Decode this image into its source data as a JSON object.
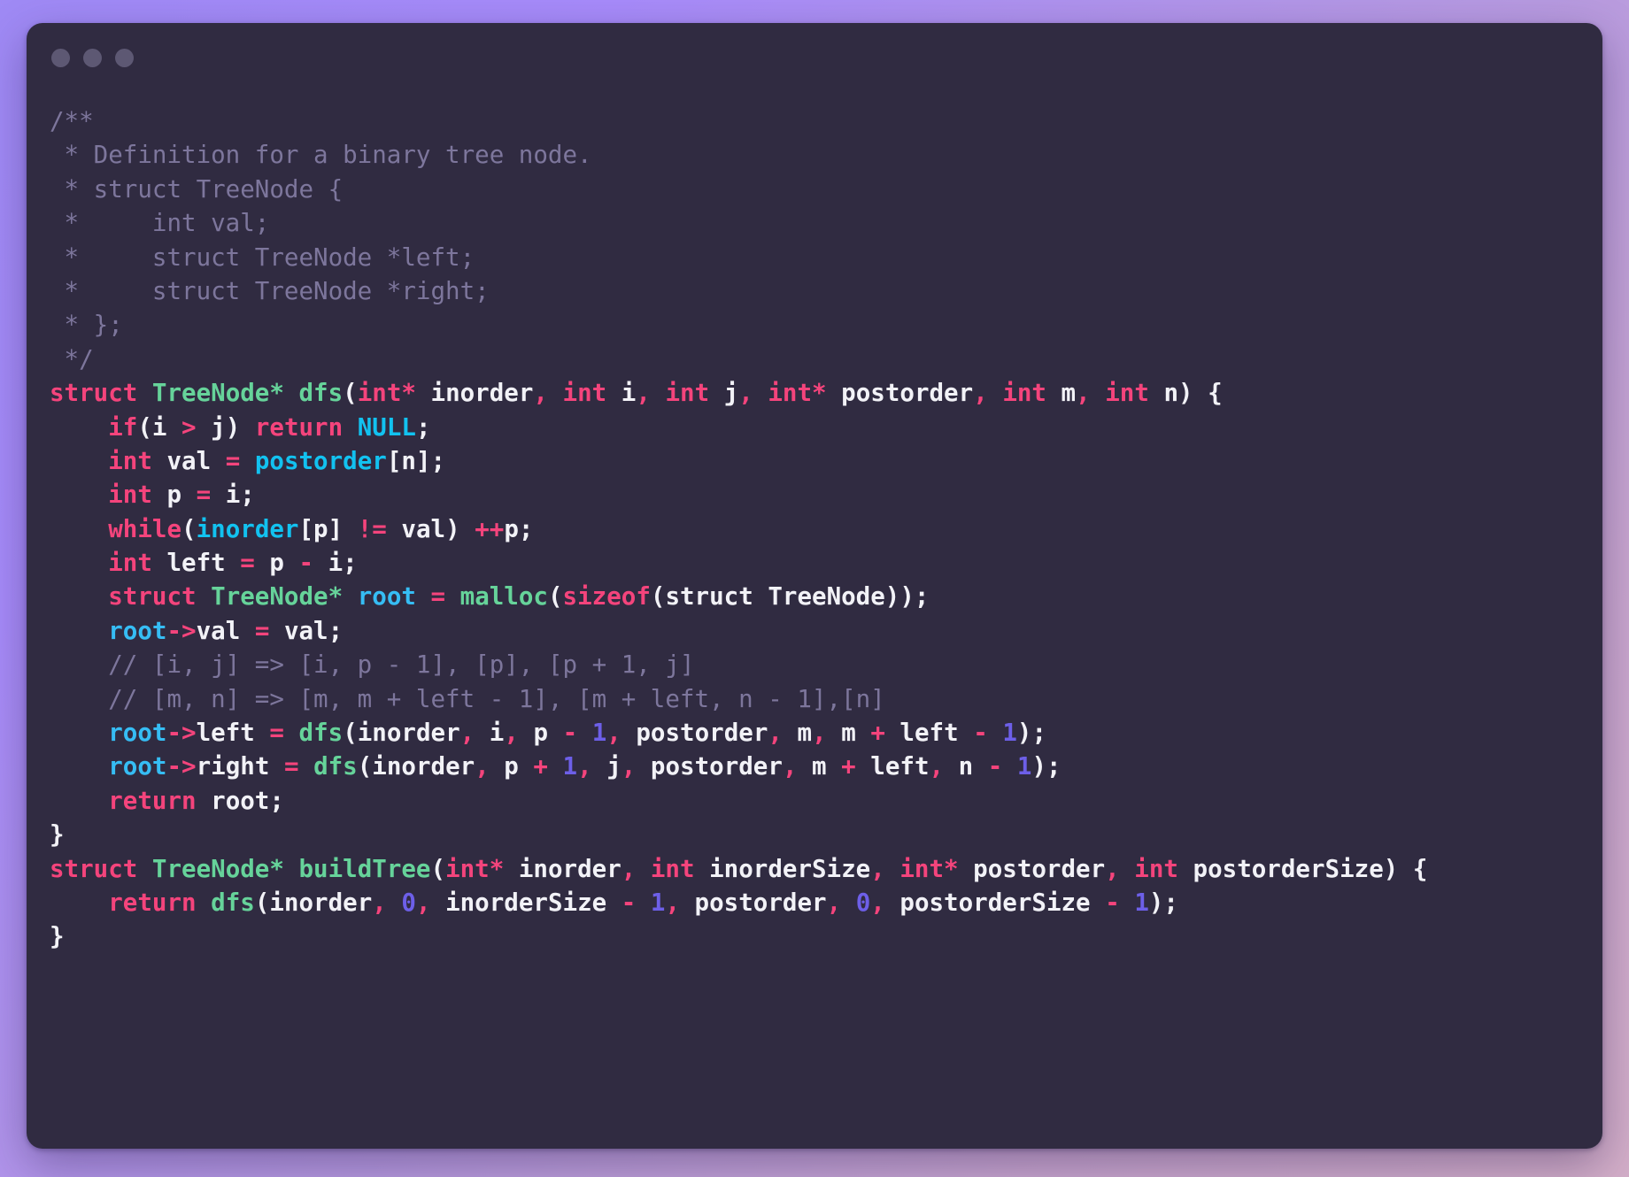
{
  "window": {
    "title_bar": {
      "dots": [
        {
          "name": "close-dot",
          "color": "#5d5873"
        },
        {
          "name": "minimize-dot",
          "color": "#5d5873"
        },
        {
          "name": "maximize-dot",
          "color": "#5d5873"
        }
      ]
    },
    "background_color": "#302b41",
    "page_background": "#a78bfa"
  },
  "theme": {
    "comment": "#7d769c",
    "keyword": "#f4447c",
    "type": "#66d39a",
    "function": "#66d39a",
    "variable": "#36bdf4",
    "constant": "#12c2f0",
    "number": "#6d5fe8",
    "operator": "#f4447c",
    "plain": "#f2f2f7"
  },
  "code": {
    "language": "c",
    "plain_text": "/**\n * Definition for a binary tree node.\n * struct TreeNode {\n *     int val;\n *     struct TreeNode *left;\n *     struct TreeNode *right;\n * };\n */\nstruct TreeNode* dfs(int* inorder, int i, int j, int* postorder, int m, int n) {\n    if(i > j) return NULL;\n    int val = postorder[n];\n    int p = i;\n    while(inorder[p] != val) ++p;\n    int left = p - i;\n    struct TreeNode* root = malloc(sizeof(struct TreeNode));\n    root->val = val;\n    // [i, j] => [i, p - 1], [p], [p + 1, j]\n    // [m, n] => [m, m + left - 1], [m + left, n - 1],[n]\n    root->left = dfs(inorder, i, p - 1, postorder, m, m + left - 1);\n    root->right = dfs(inorder, p + 1, j, postorder, m + left, n - 1);\n    return root;\n}\nstruct TreeNode* buildTree(int* inorder, int inorderSize, int* postorder, int postorderSize) {\n    return dfs(inorder, 0, inorderSize - 1, postorder, 0, postorderSize - 1);\n}",
    "lines": [
      {
        "n": 1,
        "tokens": [
          {
            "t": "/**",
            "c": "cm"
          }
        ]
      },
      {
        "n": 2,
        "tokens": [
          {
            "t": " * Definition for a binary tree node.",
            "c": "cm"
          }
        ]
      },
      {
        "n": 3,
        "tokens": [
          {
            "t": " * struct TreeNode {",
            "c": "cm"
          }
        ]
      },
      {
        "n": 4,
        "tokens": [
          {
            "t": " *     int val;",
            "c": "cm"
          }
        ]
      },
      {
        "n": 5,
        "tokens": [
          {
            "t": " *     struct TreeNode *left;",
            "c": "cm"
          }
        ]
      },
      {
        "n": 6,
        "tokens": [
          {
            "t": " *     struct TreeNode *right;",
            "c": "cm"
          }
        ]
      },
      {
        "n": 7,
        "tokens": [
          {
            "t": " * };",
            "c": "cm"
          }
        ]
      },
      {
        "n": 8,
        "tokens": [
          {
            "t": " */",
            "c": "cm"
          }
        ]
      },
      {
        "n": 9,
        "tokens": [
          {
            "t": "struct",
            "c": "kw"
          },
          {
            "t": " ",
            "c": "pl"
          },
          {
            "t": "TreeNode*",
            "c": "typ"
          },
          {
            "t": " ",
            "c": "pl"
          },
          {
            "t": "dfs",
            "c": "fn"
          },
          {
            "t": "(",
            "c": "pl"
          },
          {
            "t": "int*",
            "c": "kw"
          },
          {
            "t": " inorder",
            "c": "pl"
          },
          {
            "t": ",",
            "c": "op"
          },
          {
            "t": " ",
            "c": "pl"
          },
          {
            "t": "int",
            "c": "kw"
          },
          {
            "t": " i",
            "c": "pl"
          },
          {
            "t": ",",
            "c": "op"
          },
          {
            "t": " ",
            "c": "pl"
          },
          {
            "t": "int",
            "c": "kw"
          },
          {
            "t": " j",
            "c": "pl"
          },
          {
            "t": ",",
            "c": "op"
          },
          {
            "t": " ",
            "c": "pl"
          },
          {
            "t": "int*",
            "c": "kw"
          },
          {
            "t": " postorder",
            "c": "pl"
          },
          {
            "t": ",",
            "c": "op"
          },
          {
            "t": " ",
            "c": "pl"
          },
          {
            "t": "int",
            "c": "kw"
          },
          {
            "t": " m",
            "c": "pl"
          },
          {
            "t": ",",
            "c": "op"
          },
          {
            "t": " ",
            "c": "pl"
          },
          {
            "t": "int",
            "c": "kw"
          },
          {
            "t": " n) {",
            "c": "pl"
          }
        ]
      },
      {
        "n": 10,
        "tokens": [
          {
            "t": "    ",
            "c": "pl"
          },
          {
            "t": "if",
            "c": "kw"
          },
          {
            "t": "(i ",
            "c": "pl"
          },
          {
            "t": ">",
            "c": "op"
          },
          {
            "t": " j) ",
            "c": "pl"
          },
          {
            "t": "return",
            "c": "kw"
          },
          {
            "t": " ",
            "c": "pl"
          },
          {
            "t": "NULL",
            "c": "cst"
          },
          {
            "t": ";",
            "c": "pl"
          }
        ]
      },
      {
        "n": 11,
        "tokens": [
          {
            "t": "    ",
            "c": "pl"
          },
          {
            "t": "int",
            "c": "kw"
          },
          {
            "t": " val ",
            "c": "pl"
          },
          {
            "t": "=",
            "c": "op"
          },
          {
            "t": " ",
            "c": "pl"
          },
          {
            "t": "postorder",
            "c": "cst"
          },
          {
            "t": "[n];",
            "c": "pl"
          }
        ]
      },
      {
        "n": 12,
        "tokens": [
          {
            "t": "    ",
            "c": "pl"
          },
          {
            "t": "int",
            "c": "kw"
          },
          {
            "t": " p ",
            "c": "pl"
          },
          {
            "t": "=",
            "c": "op"
          },
          {
            "t": " i;",
            "c": "pl"
          }
        ]
      },
      {
        "n": 13,
        "tokens": [
          {
            "t": "    ",
            "c": "pl"
          },
          {
            "t": "while",
            "c": "kw"
          },
          {
            "t": "(",
            "c": "pl"
          },
          {
            "t": "inorder",
            "c": "cst"
          },
          {
            "t": "[p] ",
            "c": "pl"
          },
          {
            "t": "!=",
            "c": "op"
          },
          {
            "t": " val) ",
            "c": "pl"
          },
          {
            "t": "++",
            "c": "op"
          },
          {
            "t": "p;",
            "c": "pl"
          }
        ]
      },
      {
        "n": 14,
        "tokens": [
          {
            "t": "    ",
            "c": "pl"
          },
          {
            "t": "int",
            "c": "kw"
          },
          {
            "t": " left ",
            "c": "pl"
          },
          {
            "t": "=",
            "c": "op"
          },
          {
            "t": " p ",
            "c": "pl"
          },
          {
            "t": "-",
            "c": "op"
          },
          {
            "t": " i;",
            "c": "pl"
          }
        ]
      },
      {
        "n": 15,
        "tokens": [
          {
            "t": "    ",
            "c": "pl"
          },
          {
            "t": "struct",
            "c": "kw"
          },
          {
            "t": " ",
            "c": "pl"
          },
          {
            "t": "TreeNode*",
            "c": "typ"
          },
          {
            "t": " ",
            "c": "pl"
          },
          {
            "t": "root",
            "c": "var"
          },
          {
            "t": " ",
            "c": "pl"
          },
          {
            "t": "=",
            "c": "op"
          },
          {
            "t": " ",
            "c": "pl"
          },
          {
            "t": "malloc",
            "c": "fn"
          },
          {
            "t": "(",
            "c": "pl"
          },
          {
            "t": "sizeof",
            "c": "kw"
          },
          {
            "t": "(struct TreeNode));",
            "c": "pl"
          }
        ]
      },
      {
        "n": 16,
        "tokens": [
          {
            "t": "    ",
            "c": "pl"
          },
          {
            "t": "root",
            "c": "var"
          },
          {
            "t": "->",
            "c": "op"
          },
          {
            "t": "val ",
            "c": "pl"
          },
          {
            "t": "=",
            "c": "op"
          },
          {
            "t": " val;",
            "c": "pl"
          }
        ]
      },
      {
        "n": 17,
        "tokens": [
          {
            "t": "    // [i, j] => [i, p - 1], [p], [p + 1, j]",
            "c": "cm"
          }
        ]
      },
      {
        "n": 18,
        "tokens": [
          {
            "t": "    // [m, n] => [m, m + left - 1], [m + left, n - 1],[n]",
            "c": "cm"
          }
        ]
      },
      {
        "n": 19,
        "tokens": [
          {
            "t": "    ",
            "c": "pl"
          },
          {
            "t": "root",
            "c": "var"
          },
          {
            "t": "->",
            "c": "op"
          },
          {
            "t": "left ",
            "c": "pl"
          },
          {
            "t": "=",
            "c": "op"
          },
          {
            "t": " ",
            "c": "pl"
          },
          {
            "t": "dfs",
            "c": "fn"
          },
          {
            "t": "(inorder",
            "c": "pl"
          },
          {
            "t": ",",
            "c": "op"
          },
          {
            "t": " i",
            "c": "pl"
          },
          {
            "t": ",",
            "c": "op"
          },
          {
            "t": " p ",
            "c": "pl"
          },
          {
            "t": "-",
            "c": "op"
          },
          {
            "t": " ",
            "c": "pl"
          },
          {
            "t": "1",
            "c": "num"
          },
          {
            "t": ",",
            "c": "op"
          },
          {
            "t": " postorder",
            "c": "pl"
          },
          {
            "t": ",",
            "c": "op"
          },
          {
            "t": " m",
            "c": "pl"
          },
          {
            "t": ",",
            "c": "op"
          },
          {
            "t": " m ",
            "c": "pl"
          },
          {
            "t": "+",
            "c": "op"
          },
          {
            "t": " left ",
            "c": "pl"
          },
          {
            "t": "-",
            "c": "op"
          },
          {
            "t": " ",
            "c": "pl"
          },
          {
            "t": "1",
            "c": "num"
          },
          {
            "t": ");",
            "c": "pl"
          }
        ]
      },
      {
        "n": 20,
        "tokens": [
          {
            "t": "    ",
            "c": "pl"
          },
          {
            "t": "root",
            "c": "var"
          },
          {
            "t": "->",
            "c": "op"
          },
          {
            "t": "right ",
            "c": "pl"
          },
          {
            "t": "=",
            "c": "op"
          },
          {
            "t": " ",
            "c": "pl"
          },
          {
            "t": "dfs",
            "c": "fn"
          },
          {
            "t": "(inorder",
            "c": "pl"
          },
          {
            "t": ",",
            "c": "op"
          },
          {
            "t": " p ",
            "c": "pl"
          },
          {
            "t": "+",
            "c": "op"
          },
          {
            "t": " ",
            "c": "pl"
          },
          {
            "t": "1",
            "c": "num"
          },
          {
            "t": ",",
            "c": "op"
          },
          {
            "t": " j",
            "c": "pl"
          },
          {
            "t": ",",
            "c": "op"
          },
          {
            "t": " postorder",
            "c": "pl"
          },
          {
            "t": ",",
            "c": "op"
          },
          {
            "t": " m ",
            "c": "pl"
          },
          {
            "t": "+",
            "c": "op"
          },
          {
            "t": " left",
            "c": "pl"
          },
          {
            "t": ",",
            "c": "op"
          },
          {
            "t": " n ",
            "c": "pl"
          },
          {
            "t": "-",
            "c": "op"
          },
          {
            "t": " ",
            "c": "pl"
          },
          {
            "t": "1",
            "c": "num"
          },
          {
            "t": ");",
            "c": "pl"
          }
        ]
      },
      {
        "n": 21,
        "tokens": [
          {
            "t": "    ",
            "c": "pl"
          },
          {
            "t": "return",
            "c": "kw"
          },
          {
            "t": " root;",
            "c": "pl"
          }
        ]
      },
      {
        "n": 22,
        "tokens": [
          {
            "t": "}",
            "c": "pl"
          }
        ]
      },
      {
        "n": 23,
        "tokens": [
          {
            "t": "struct",
            "c": "kw"
          },
          {
            "t": " ",
            "c": "pl"
          },
          {
            "t": "TreeNode*",
            "c": "typ"
          },
          {
            "t": " ",
            "c": "pl"
          },
          {
            "t": "buildTree",
            "c": "fn"
          },
          {
            "t": "(",
            "c": "pl"
          },
          {
            "t": "int*",
            "c": "kw"
          },
          {
            "t": " inorder",
            "c": "pl"
          },
          {
            "t": ",",
            "c": "op"
          },
          {
            "t": " ",
            "c": "pl"
          },
          {
            "t": "int",
            "c": "kw"
          },
          {
            "t": " inorderSize",
            "c": "pl"
          },
          {
            "t": ",",
            "c": "op"
          },
          {
            "t": " ",
            "c": "pl"
          },
          {
            "t": "int*",
            "c": "kw"
          },
          {
            "t": " postorder",
            "c": "pl"
          },
          {
            "t": ",",
            "c": "op"
          },
          {
            "t": " ",
            "c": "pl"
          },
          {
            "t": "int",
            "c": "kw"
          },
          {
            "t": " postorderSize) {",
            "c": "pl"
          }
        ]
      },
      {
        "n": 24,
        "tokens": [
          {
            "t": "    ",
            "c": "pl"
          },
          {
            "t": "return",
            "c": "kw"
          },
          {
            "t": " ",
            "c": "pl"
          },
          {
            "t": "dfs",
            "c": "fn"
          },
          {
            "t": "(inorder",
            "c": "pl"
          },
          {
            "t": ",",
            "c": "op"
          },
          {
            "t": " ",
            "c": "pl"
          },
          {
            "t": "0",
            "c": "num"
          },
          {
            "t": ",",
            "c": "op"
          },
          {
            "t": " inorderSize ",
            "c": "pl"
          },
          {
            "t": "-",
            "c": "op"
          },
          {
            "t": " ",
            "c": "pl"
          },
          {
            "t": "1",
            "c": "num"
          },
          {
            "t": ",",
            "c": "op"
          },
          {
            "t": " postorder",
            "c": "pl"
          },
          {
            "t": ",",
            "c": "op"
          },
          {
            "t": " ",
            "c": "pl"
          },
          {
            "t": "0",
            "c": "num"
          },
          {
            "t": ",",
            "c": "op"
          },
          {
            "t": " postorderSize ",
            "c": "pl"
          },
          {
            "t": "-",
            "c": "op"
          },
          {
            "t": " ",
            "c": "pl"
          },
          {
            "t": "1",
            "c": "num"
          },
          {
            "t": ");",
            "c": "pl"
          }
        ]
      },
      {
        "n": 25,
        "tokens": [
          {
            "t": "}",
            "c": "pl"
          }
        ]
      }
    ]
  }
}
